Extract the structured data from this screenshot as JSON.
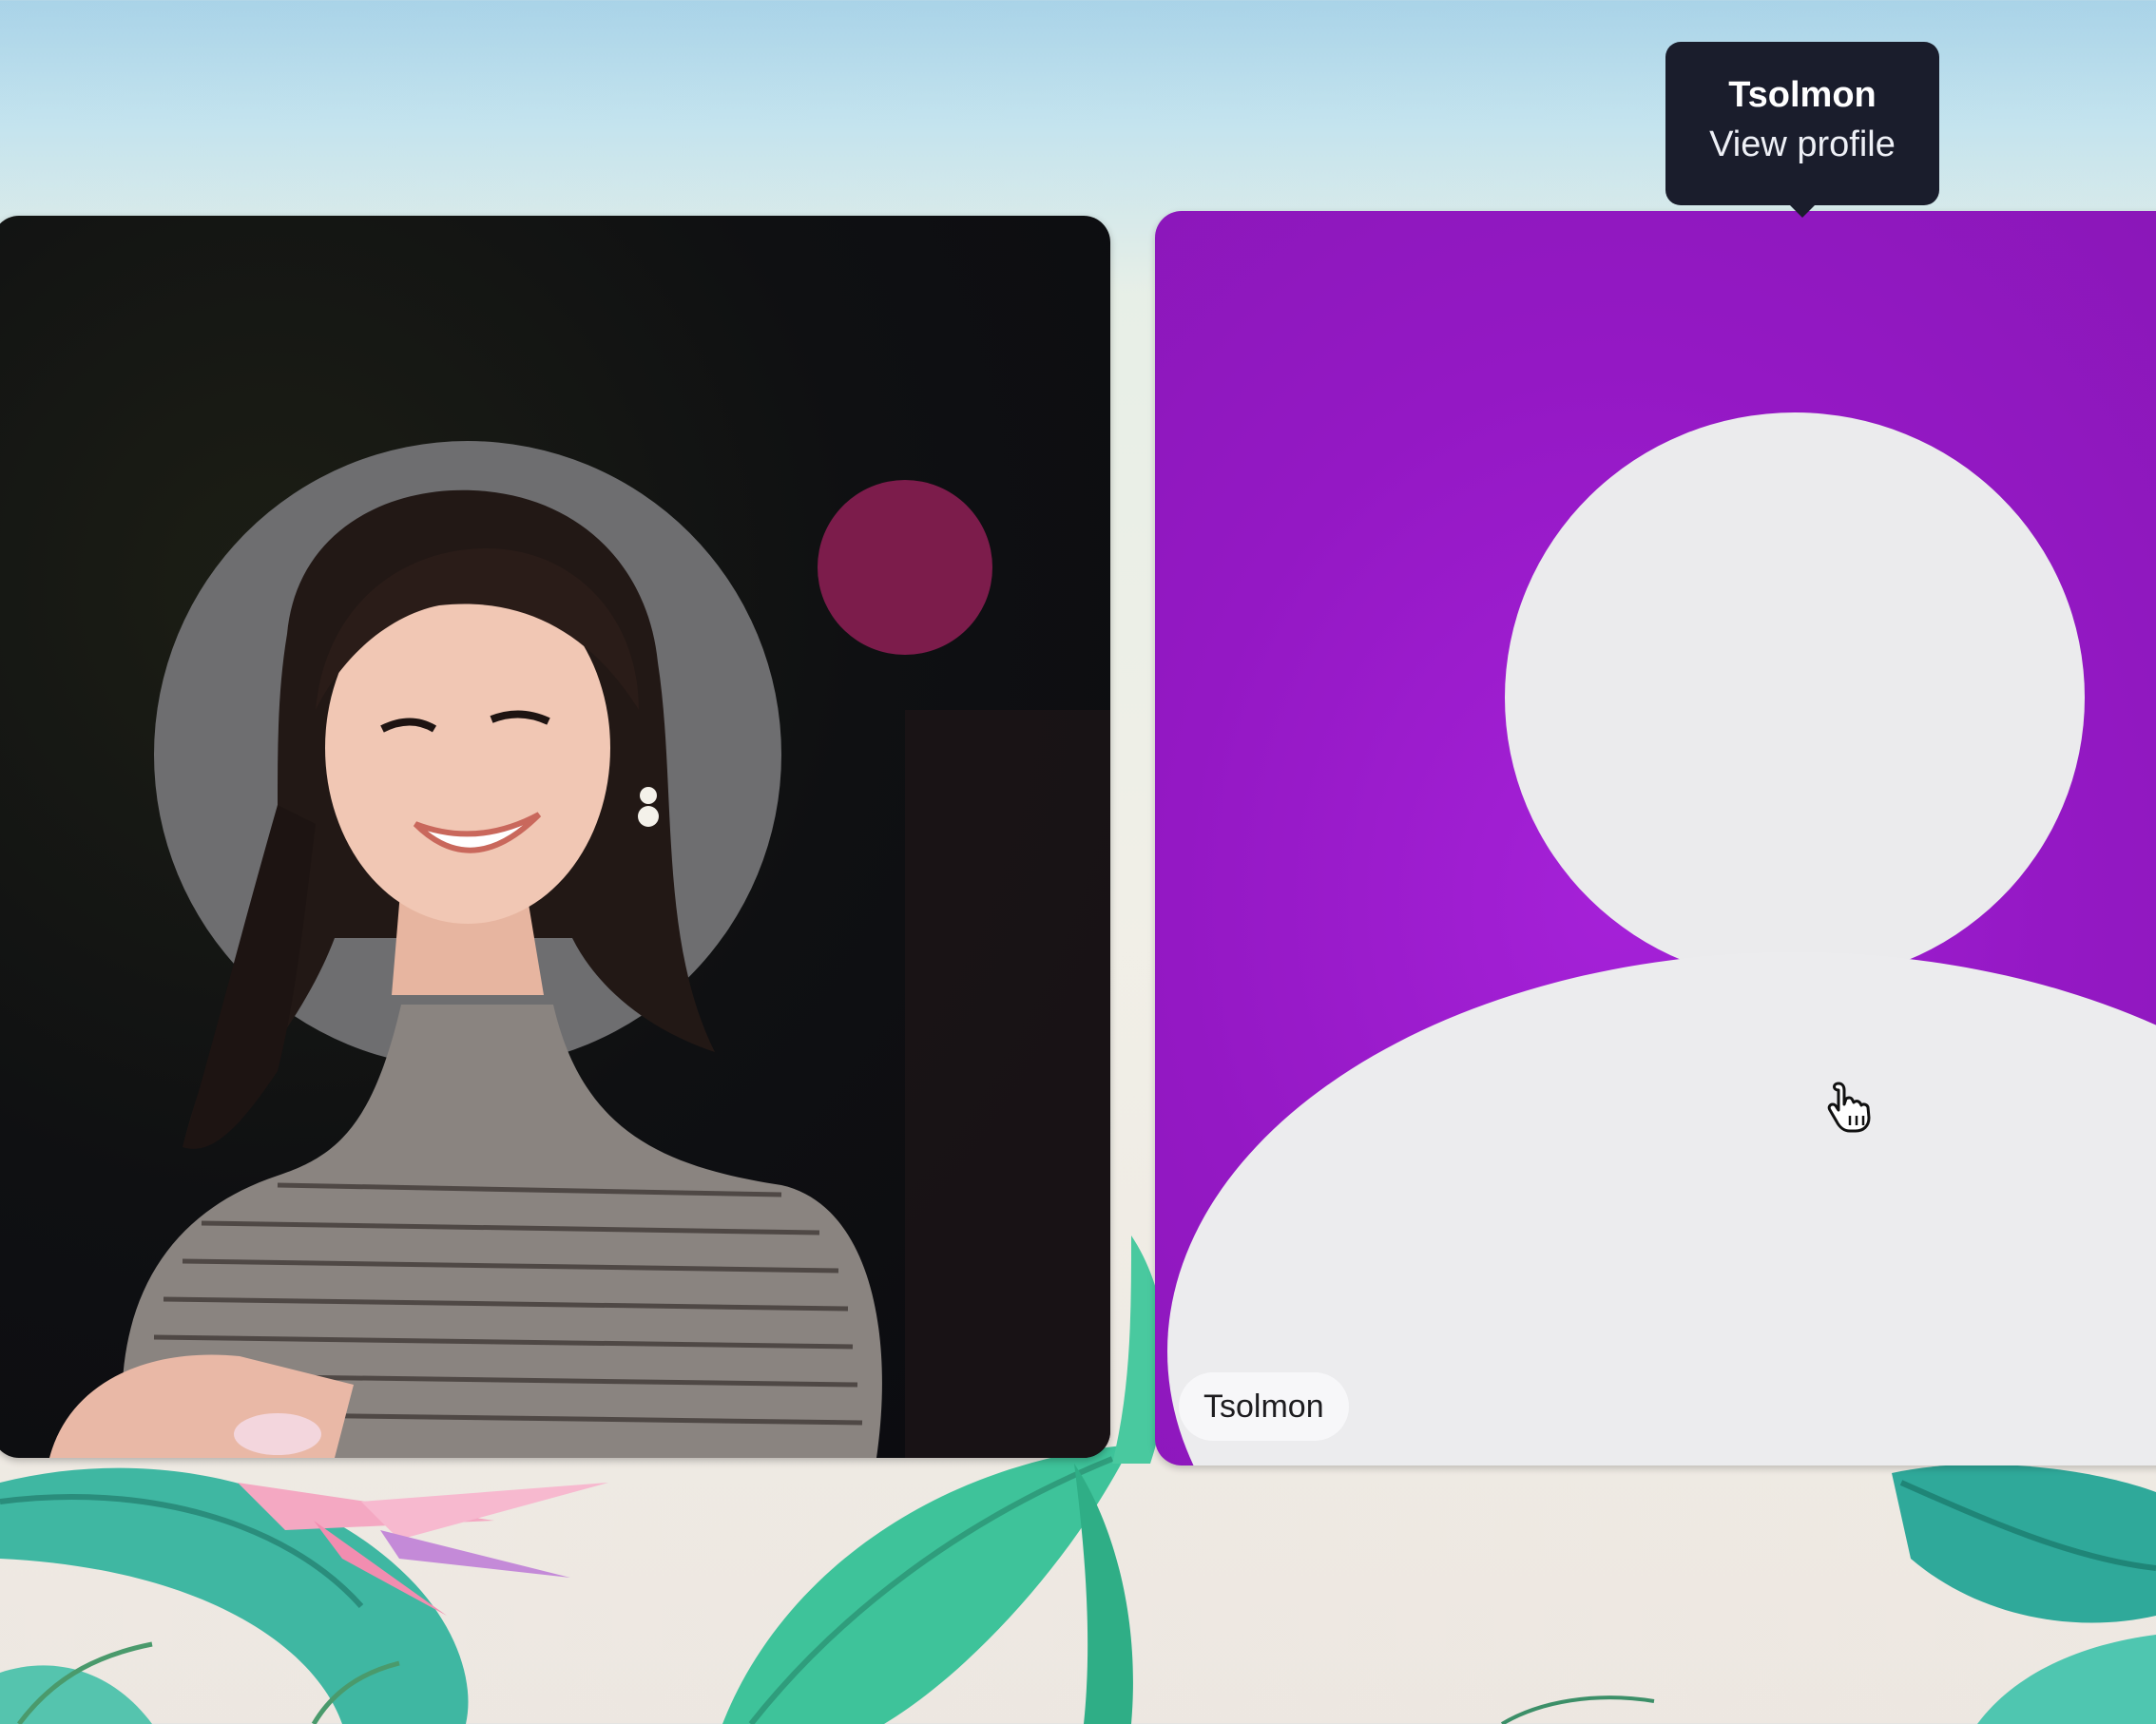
{
  "theme": {
    "accent_purple": "#9a1ccb",
    "tooltip_bg": "#1a1d2c",
    "tile_dark": "#0d0e12"
  },
  "participants": [
    {
      "name": "Tsolmon",
      "has_video": false,
      "avatar": "default-person-silhouette",
      "tile_color": "#9a1ccb"
    }
  ],
  "tooltip": {
    "name": "Tsolmon",
    "action": "View profile"
  },
  "name_tag": {
    "label": "Tsolmon"
  },
  "icons": {
    "cursor": "hand-pointer-icon",
    "default_avatar": "person-silhouette-icon"
  }
}
